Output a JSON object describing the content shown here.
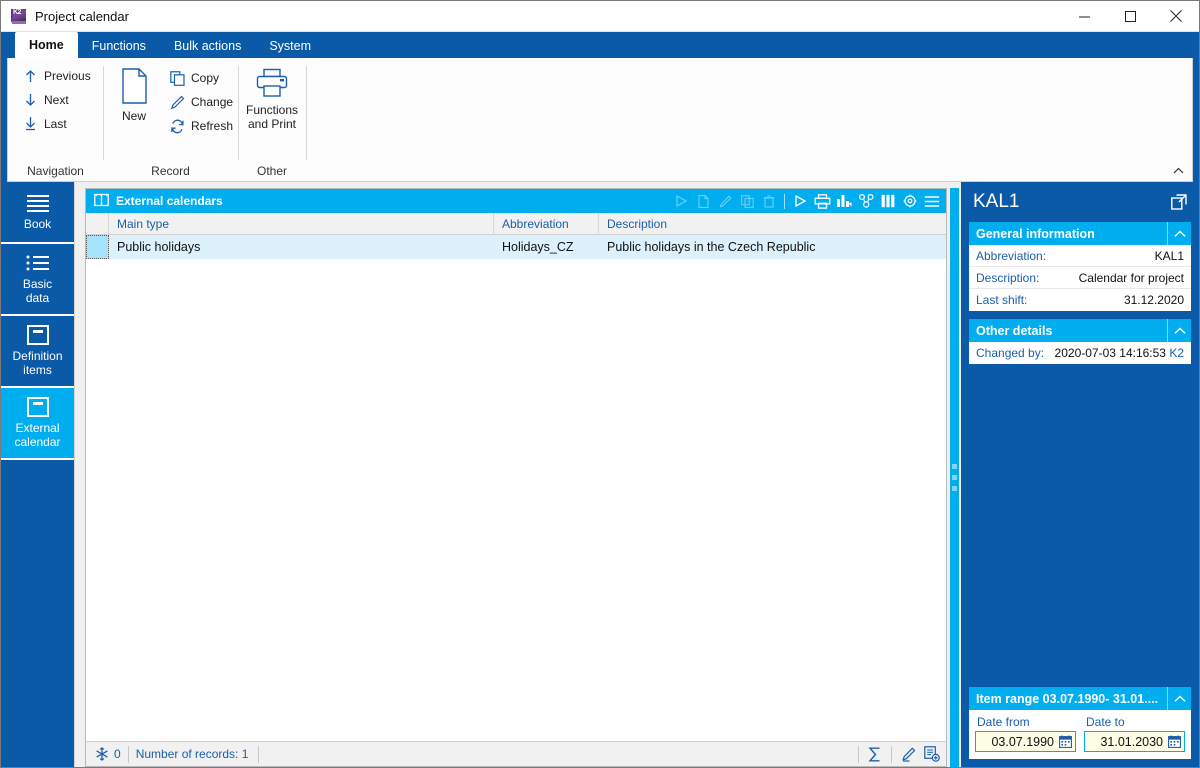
{
  "window": {
    "title": "Project calendar",
    "icon": "k2-logo-icon",
    "minimize": "minimize-button",
    "maximize": "maximize-button",
    "close": "close-button"
  },
  "ribbon": {
    "tabs": [
      {
        "label": "Home",
        "active": true
      },
      {
        "label": "Functions",
        "active": false
      },
      {
        "label": "Bulk actions",
        "active": false
      },
      {
        "label": "System",
        "active": false
      }
    ],
    "groups": [
      {
        "label": "Navigation",
        "items": [
          {
            "label": "Previous",
            "icon": "arrow-up-icon"
          },
          {
            "label": "Next",
            "icon": "arrow-down-icon"
          },
          {
            "label": "Last",
            "icon": "arrow-down-to-line-icon"
          }
        ]
      },
      {
        "label": "Record",
        "big": {
          "label": "New",
          "icon": "new-document-icon"
        },
        "items": [
          {
            "label": "Copy",
            "icon": "copy-icon"
          },
          {
            "label": "Change",
            "icon": "pencil-icon"
          },
          {
            "label": "Refresh",
            "icon": "refresh-icon"
          }
        ]
      },
      {
        "label": "Other",
        "big": {
          "label": "Functions\nand Print",
          "label_line1": "Functions",
          "label_line2": "and Print",
          "icon": "printer-icon"
        },
        "items": []
      }
    ],
    "collapse": "collapse-ribbon-chevron"
  },
  "sidebar": {
    "items": [
      {
        "label": "Book",
        "icon": "list-lines-icon",
        "selected": false
      },
      {
        "label_line1": "Basic",
        "label_line2": "data",
        "icon": "bullet-list-icon",
        "selected": false
      },
      {
        "label_line1": "Definition",
        "label_line2": "items",
        "icon": "archive-box-icon",
        "selected": false
      },
      {
        "label_line1": "External",
        "label_line2": "calendar",
        "icon": "archive-box-icon",
        "selected": true
      }
    ]
  },
  "grid": {
    "title": "External calendars",
    "title_icon": "book-open-icon",
    "toolbar": [
      {
        "name": "run-dim-icon",
        "enabled": false
      },
      {
        "name": "new-record-dim-icon",
        "enabled": false
      },
      {
        "name": "edit-dim-icon",
        "enabled": false
      },
      {
        "name": "copy-dim-icon",
        "enabled": false
      },
      {
        "name": "delete-dim-icon",
        "enabled": false
      },
      {
        "name": "run-icon",
        "enabled": true
      },
      {
        "name": "print-icon",
        "enabled": true
      },
      {
        "name": "chart-icon",
        "enabled": true
      },
      {
        "name": "group-tree-icon",
        "enabled": true
      },
      {
        "name": "columns-icon",
        "enabled": true
      },
      {
        "name": "settings-gear-icon",
        "enabled": true
      },
      {
        "name": "hamburger-menu-icon",
        "enabled": true
      }
    ],
    "columns": [
      "Main type",
      "Abbreviation",
      "Description"
    ],
    "rows": [
      {
        "main_type": "Public holidays",
        "abbreviation": "Holidays_CZ",
        "description": "Public holidays in the Czech Republic",
        "selected": true
      }
    ],
    "status": {
      "filter_icon": "snowflake-filter-icon",
      "filter_count": "0",
      "records_text": "Number of records: 1",
      "right_icons": [
        {
          "name": "sum-sigma-icon"
        },
        {
          "name": "pencil-edit-icon"
        },
        {
          "name": "add-document-icon"
        }
      ]
    }
  },
  "splitter": {
    "name": "panel-splitter"
  },
  "details": {
    "title": "KAL1",
    "expand_icon": "open-in-new-window-icon",
    "sections": [
      {
        "header": "General information",
        "chevron": "chevron-up-icon",
        "fields": [
          {
            "label": "Abbreviation:",
            "value": "KAL1",
            "suffix": ""
          },
          {
            "label": "Description:",
            "value": "Calendar for project",
            "suffix": ""
          },
          {
            "label": "Last shift:",
            "value": "31.12.2020",
            "suffix": ""
          }
        ]
      },
      {
        "header": "Other details",
        "chevron": "chevron-up-icon",
        "fields": [
          {
            "label": "Changed by:",
            "value": "2020-07-03 14:16:53 ",
            "suffix": "K2"
          }
        ]
      }
    ],
    "item_range": {
      "header": "Item range 03.07.1990- 31.01....",
      "chevron": "chevron-up-icon",
      "date_from": {
        "label": "Date from",
        "value": "03.07.1990",
        "icon": "calendar-icon"
      },
      "date_to": {
        "label": "Date to",
        "value": "31.01.2030",
        "icon": "calendar-icon"
      }
    }
  },
  "colors": {
    "ribbon_blue": "#0a5aa8",
    "accent_cyan": "#00adef",
    "panel_blue": "#0a5aa8",
    "row_selected": "#ddf1fc",
    "field_yellow": "#fdfce4",
    "label_blue": "#1b5fa8"
  }
}
